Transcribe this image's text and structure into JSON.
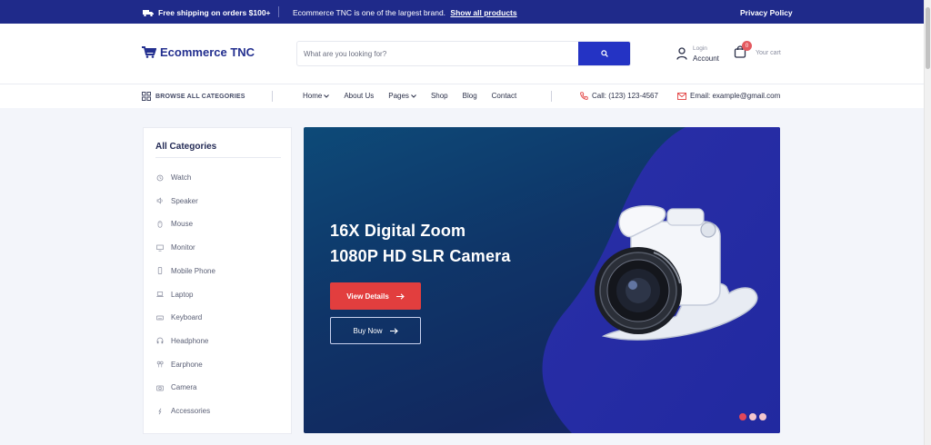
{
  "topbar": {
    "shipping": "Free shipping on orders $100+",
    "brand_message": "Ecommerce TNC is one of the largest brand.",
    "show_all": "Show all products",
    "privacy": "Privacy Policy"
  },
  "header": {
    "logo": "Ecommerce TNC",
    "search_placeholder": "What are you looking for?",
    "login_label": "Login",
    "account_label": "Account",
    "cart_count": "0",
    "cart_label": "Your cart"
  },
  "nav": {
    "browse": "BROWSE ALL CATEGORIES",
    "items": [
      "Home",
      "About Us",
      "Pages",
      "Shop",
      "Blog",
      "Contact"
    ],
    "phone": "Call: (123) 123-4567",
    "email": "Email: example@gmail.com"
  },
  "sidebar": {
    "title": "All Categories",
    "items": [
      "Watch",
      "Speaker",
      "Mouse",
      "Monitor",
      "Mobile Phone",
      "Laptop",
      "Keyboard",
      "Headphone",
      "Earphone",
      "Camera",
      "Accessories"
    ],
    "icons": [
      "watch-icon",
      "speaker-icon",
      "mouse-icon",
      "monitor-icon",
      "mobile-phone-icon",
      "laptop-icon",
      "keyboard-icon",
      "headphone-icon",
      "earphone-icon",
      "camera-icon",
      "accessories-icon"
    ]
  },
  "hero": {
    "line1": "16X Digital Zoom",
    "line2": "1080P HD SLR Camera",
    "view_details": "View Details",
    "buy_now": "Buy Now",
    "slide_count": 3,
    "active_slide": 1
  },
  "colors": {
    "primary": "#1f2a8a",
    "search_button": "#2433c4",
    "accent_red": "#e23e3e",
    "badge": "#e45a60"
  }
}
